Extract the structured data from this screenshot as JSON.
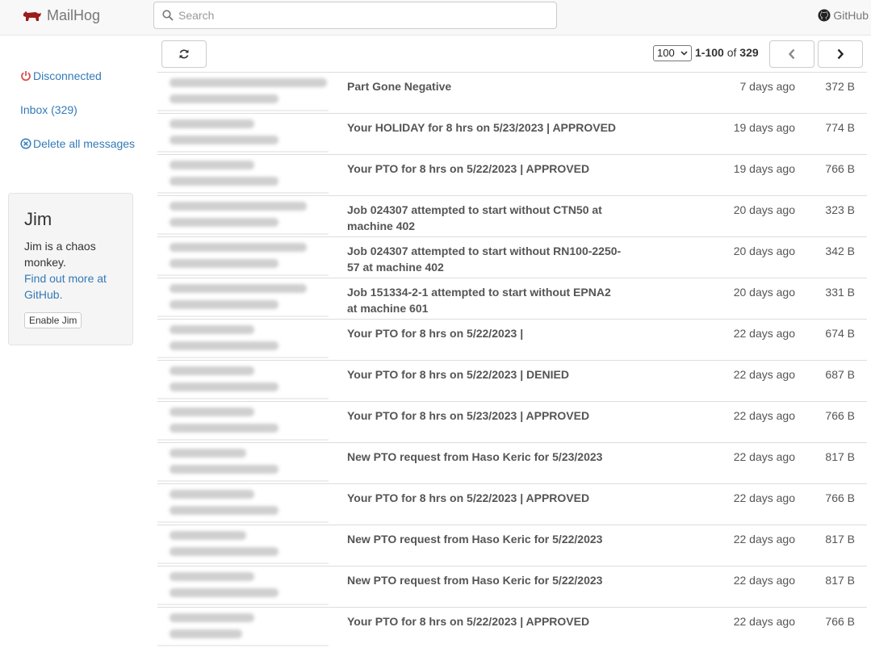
{
  "brand": {
    "name": "MailHog"
  },
  "search": {
    "placeholder": "Search"
  },
  "github": {
    "label": "GitHub"
  },
  "sidebar": {
    "status": "Disconnected",
    "inbox": "Inbox (329)",
    "delete_all": "Delete all messages"
  },
  "jim": {
    "title": "Jim",
    "description": "Jim is a chaos monkey.",
    "link": "Find out more at GitHub.",
    "button": "Enable Jim"
  },
  "pager": {
    "page_size": "100",
    "range": "1-100",
    "of": "of",
    "total": "329"
  },
  "messages": [
    {
      "subject": "Part Gone Negative",
      "date": "7 days ago",
      "size": "372 B"
    },
    {
      "subject": "Your HOLIDAY for 8 hrs on 5/23/2023 | APPROVED",
      "date": "19 days ago",
      "size": "774 B"
    },
    {
      "subject": "Your PTO for 8 hrs on 5/22/2023 | APPROVED",
      "date": "19 days ago",
      "size": "766 B"
    },
    {
      "subject": "Job 024307 attempted to start without CTN50 at machine 402",
      "date": "20 days ago",
      "size": "323 B"
    },
    {
      "subject": "Job 024307 attempted to start without RN100-2250-57 at machine 402",
      "date": "20 days ago",
      "size": "342 B"
    },
    {
      "subject": "Job 151334-2-1 attempted to start without EPNA2 at machine 601",
      "date": "20 days ago",
      "size": "331 B"
    },
    {
      "subject": "Your PTO for 8 hrs on 5/22/2023 |",
      "date": "22 days ago",
      "size": "674 B"
    },
    {
      "subject": "Your PTO for 8 hrs on 5/22/2023 | DENIED",
      "date": "22 days ago",
      "size": "687 B"
    },
    {
      "subject": "Your PTO for 8 hrs on 5/23/2023 | APPROVED",
      "date": "22 days ago",
      "size": "766 B"
    },
    {
      "subject": "New PTO request from Haso Keric for 5/23/2023",
      "date": "22 days ago",
      "size": "817 B"
    },
    {
      "subject": "Your PTO for 8 hrs on 5/22/2023 | APPROVED",
      "date": "22 days ago",
      "size": "766 B"
    },
    {
      "subject": "New PTO request from Haso Keric for 5/22/2023",
      "date": "22 days ago",
      "size": "817 B"
    },
    {
      "subject": "New PTO request from Haso Keric for 5/22/2023",
      "date": "22 days ago",
      "size": "817 B"
    },
    {
      "subject": "Your PTO for 8 hrs on 5/22/2023 | APPROVED",
      "date": "22 days ago",
      "size": "766 B"
    }
  ],
  "colors": {
    "link": "#337ab7",
    "danger": "#d9534f",
    "brand_icon": "#9c1b1b"
  }
}
